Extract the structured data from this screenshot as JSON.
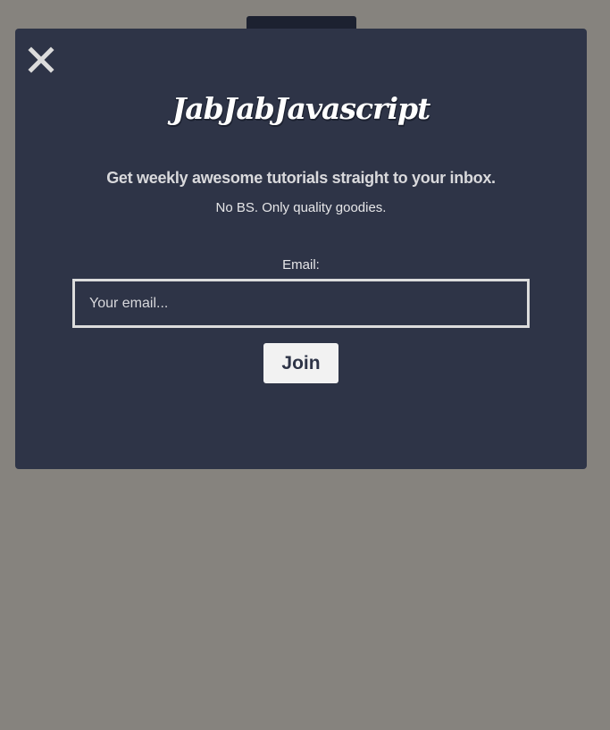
{
  "modal": {
    "close_icon": "close-icon",
    "brand": "JabJabJavascript",
    "headline": "Get weekly awesome tutorials straight to your inbox.",
    "subline": "No BS. Only quality goodies.",
    "email_label": "Email:",
    "email_placeholder": "Your email...",
    "email_value": "",
    "join_label": "Join"
  },
  "colors": {
    "overlay": "#86837e",
    "modal_bg": "#2e3447",
    "text": "#e6e6e8",
    "button_bg": "#f2f2f2"
  }
}
